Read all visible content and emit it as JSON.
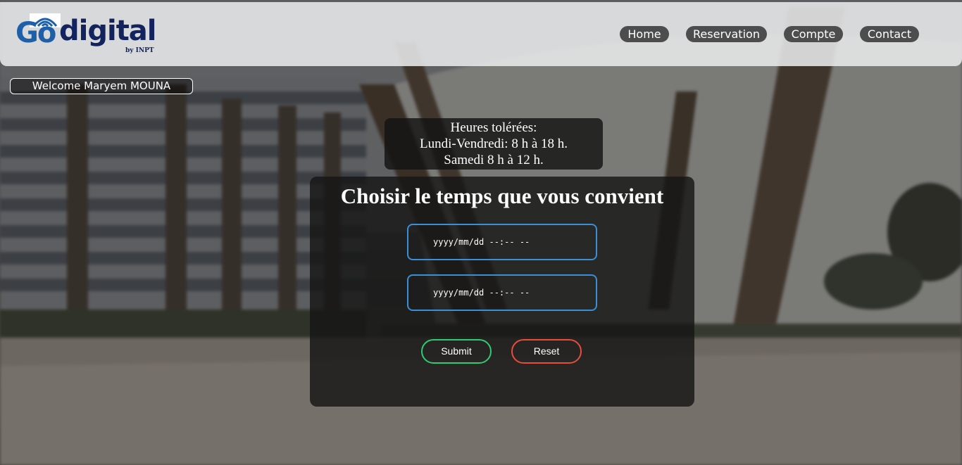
{
  "header": {
    "logo": {
      "go": "Go",
      "digital": "digital",
      "by": "by INPT"
    },
    "nav": [
      {
        "label": "Home"
      },
      {
        "label": "Reservation"
      },
      {
        "label": "Compte"
      },
      {
        "label": "Contact"
      }
    ]
  },
  "welcome": {
    "text": "Welcome Maryem MOUNA"
  },
  "hours": {
    "title": "Heures tolérées:",
    "weekdays": "Lundi-Vendredi: 8 h à 18 h.",
    "saturday": "Samedi 8 h à 12 h."
  },
  "form": {
    "title": "Choisir le temps que vous convient",
    "start_placeholder": "yyyy/mm/dd --:-- --",
    "end_placeholder": "yyyy/mm/dd --:-- --",
    "submit_label": "Submit",
    "reset_label": "Reset"
  },
  "colors": {
    "header_bg": "#e8e9eb",
    "nav_bg": "#4d4d4d",
    "logo_blue": "#1d5fa8",
    "logo_navy": "#13235e",
    "input_border": "#3a8fd8",
    "submit_border": "#2ecc71",
    "reset_border": "#e74c3c"
  }
}
